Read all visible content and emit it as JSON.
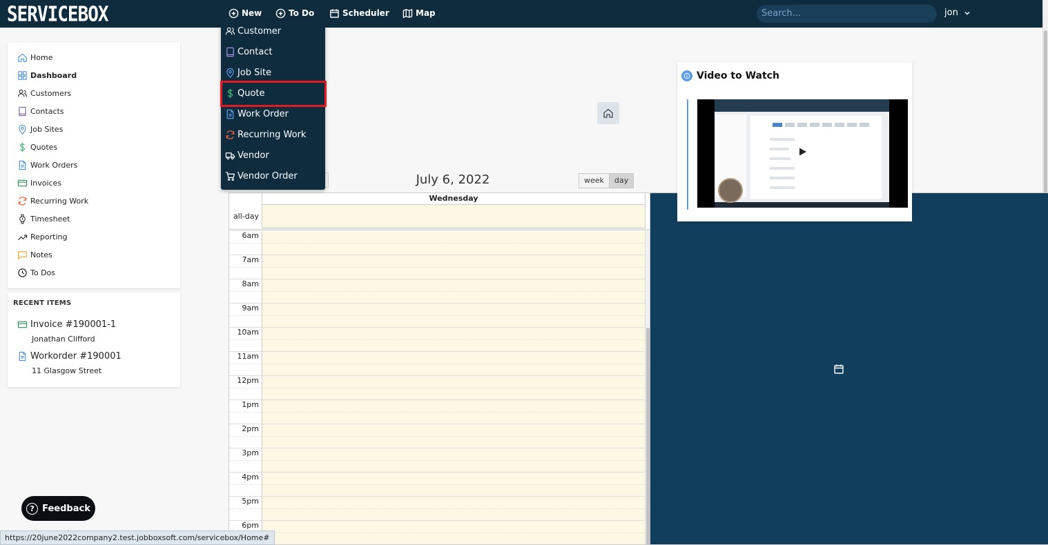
{
  "app": {
    "logo": "SERVICEBOX"
  },
  "nav": {
    "new": "New",
    "todo": "To Do",
    "scheduler": "Scheduler",
    "map": "Map",
    "search_placeholder": "Search...",
    "user": "jon"
  },
  "new_menu": {
    "items": [
      {
        "label": "Customer",
        "icon": "users-icon"
      },
      {
        "label": "Contact",
        "icon": "book-icon"
      },
      {
        "label": "Job Site",
        "icon": "location-pin-icon"
      },
      {
        "label": "Quote",
        "icon": "dollar-icon"
      },
      {
        "label": "Work Order",
        "icon": "document-icon"
      },
      {
        "label": "Recurring Work",
        "icon": "refresh-icon"
      },
      {
        "label": "Vendor",
        "icon": "truck-icon"
      },
      {
        "label": "Vendor Order",
        "icon": "cart-icon"
      }
    ],
    "highlighted": "Quote"
  },
  "sidebar": {
    "items": [
      {
        "label": "Home",
        "icon": "home-icon"
      },
      {
        "label": "Dashboard",
        "icon": "grid-icon"
      },
      {
        "label": "Customers",
        "icon": "users-icon"
      },
      {
        "label": "Contacts",
        "icon": "book-icon"
      },
      {
        "label": "Job Sites",
        "icon": "location-pin-icon"
      },
      {
        "label": "Quotes",
        "icon": "dollar-icon"
      },
      {
        "label": "Work Orders",
        "icon": "document-icon"
      },
      {
        "label": "Invoices",
        "icon": "credit-card-icon"
      },
      {
        "label": "Recurring Work",
        "icon": "refresh-icon"
      },
      {
        "label": "Timesheet",
        "icon": "watch-icon"
      },
      {
        "label": "Reporting",
        "icon": "trend-icon"
      },
      {
        "label": "Notes",
        "icon": "note-icon"
      },
      {
        "label": "To Dos",
        "icon": "clock-icon"
      }
    ],
    "active": "Dashboard"
  },
  "recent": {
    "title": "RECENT ITEMS",
    "items": [
      {
        "label": "Invoice #190001-1",
        "sub": "Jonathan Clifford",
        "icon": "credit-card-icon"
      },
      {
        "label": "Workorder #190001",
        "sub": "11 Glasgow Street",
        "icon": "document-icon"
      }
    ]
  },
  "calendar": {
    "title": "July 6, 2022",
    "views": [
      "week",
      "day"
    ],
    "active_view": "day",
    "day_header": "Wednesday",
    "allday": "all-day",
    "hours": [
      "6am",
      "7am",
      "8am",
      "9am",
      "10am",
      "11am",
      "12pm",
      "1pm",
      "2pm",
      "3pm",
      "4pm",
      "5pm",
      "6pm"
    ]
  },
  "video": {
    "title": "Video to Watch"
  },
  "feedback": {
    "label": "Feedback"
  },
  "status_url": "https://20june2022company2.test.jobboxsoft.com/servicebox/Home#",
  "colors": {
    "topbar": "#0f2c3f",
    "highlight": "#e21b23",
    "slot_bg": "#fcf8e3",
    "accent_blue": "#5b9be6"
  }
}
